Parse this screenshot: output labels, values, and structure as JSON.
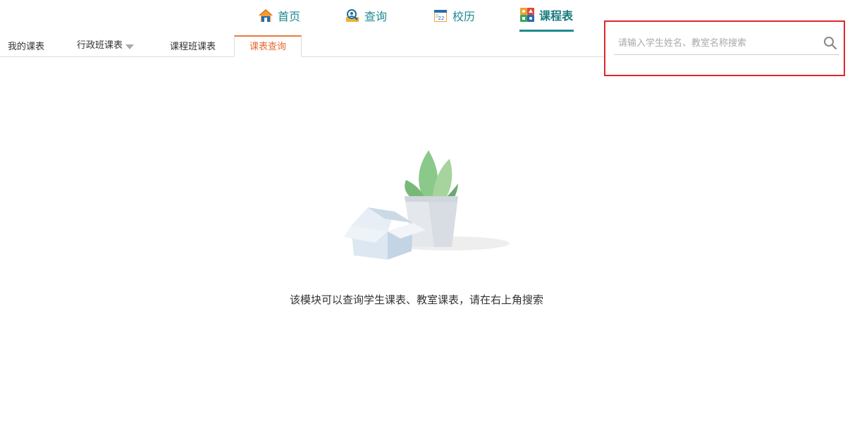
{
  "top_nav": {
    "items": [
      {
        "label": "首页",
        "icon": "home-icon"
      },
      {
        "label": "查询",
        "icon": "search-person-icon"
      },
      {
        "label": "校历",
        "icon": "calendar-icon"
      },
      {
        "label": "课程表",
        "icon": "schedule-icon",
        "active": true
      }
    ]
  },
  "sub_tabs": {
    "items": [
      {
        "label": "我的课表"
      },
      {
        "label": "行政班课表"
      },
      {
        "label": "课程班课表"
      },
      {
        "label": "课表查询",
        "active": true
      }
    ]
  },
  "search": {
    "placeholder": "请输入学生姓名、教室名称搜索",
    "value": ""
  },
  "empty_state": {
    "message": "该模块可以查询学生课表、教室课表，请在右上角搜索"
  },
  "colors": {
    "accent": "#1f8a8f",
    "active_tab": "#e36a2c",
    "highlight_box": "#e0262b"
  }
}
